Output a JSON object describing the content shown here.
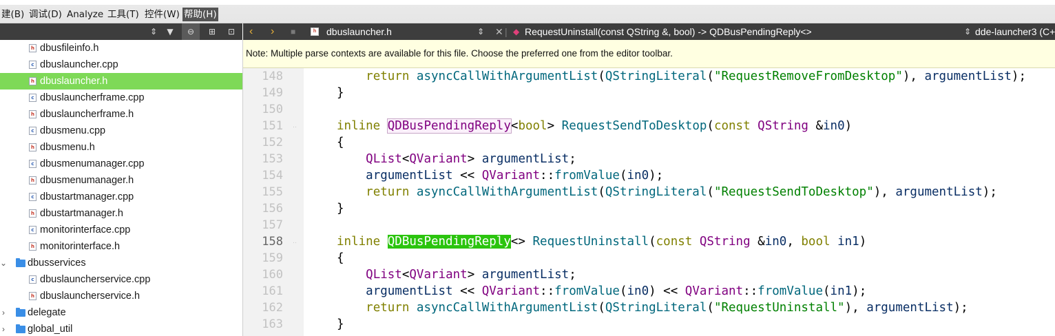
{
  "menubar": {
    "items": [
      {
        "label": "建(B)"
      },
      {
        "label": "调试(D)"
      },
      {
        "label": "Analyze"
      },
      {
        "label": "工具(T)"
      },
      {
        "label": "控件(W)"
      },
      {
        "label": "帮助(H)"
      }
    ]
  },
  "sidebar": {
    "toolbar_icons": [
      "updown-arrows-icon",
      "filter-icon",
      "link-icon",
      "split-add-icon",
      "close-panel-icon"
    ],
    "items": [
      {
        "label": "dbusfileinfo.h",
        "type": "h"
      },
      {
        "label": "dbuslauncher.cpp",
        "type": "cpp"
      },
      {
        "label": "dbuslauncher.h",
        "type": "h",
        "selected": true
      },
      {
        "label": "dbuslauncherframe.cpp",
        "type": "cpp"
      },
      {
        "label": "dbuslauncherframe.h",
        "type": "h"
      },
      {
        "label": "dbusmenu.cpp",
        "type": "cpp"
      },
      {
        "label": "dbusmenu.h",
        "type": "h"
      },
      {
        "label": "dbusmenumanager.cpp",
        "type": "cpp"
      },
      {
        "label": "dbusmenumanager.h",
        "type": "h"
      },
      {
        "label": "dbustartmanager.cpp",
        "type": "cpp"
      },
      {
        "label": "dbustartmanager.h",
        "type": "h"
      },
      {
        "label": "monitorinterface.cpp",
        "type": "cpp"
      },
      {
        "label": "monitorinterface.h",
        "type": "h"
      },
      {
        "label": "dbusservices",
        "type": "folder",
        "expanded": true
      },
      {
        "label": "dbuslauncherservice.cpp",
        "type": "cpp"
      },
      {
        "label": "dbuslauncherservice.h",
        "type": "h"
      },
      {
        "label": "delegate",
        "type": "folder",
        "expanded": false
      },
      {
        "label": "global_util",
        "type": "folder",
        "expanded": false
      }
    ]
  },
  "editor_toolbar": {
    "file_name": "dbuslauncher.h",
    "symbol": "RequestUninstall(const QString &, bool) -> QDBusPendingReply<>",
    "context": "dde-launcher3 (C+"
  },
  "notification": {
    "text": "Note: Multiple parse contexts are available for this file. Choose the preferred one from the editor toolbar."
  },
  "editor": {
    "current_line": 158,
    "line_numbers": [
      "148",
      "149",
      "150",
      "151",
      "152",
      "153",
      "154",
      "155",
      "156",
      "157",
      "158",
      "159",
      "160",
      "161",
      "162",
      "163"
    ],
    "folded_lines": [
      151,
      158
    ],
    "colors": {
      "keyword": "#808000",
      "type": "#800080",
      "function": "#00677c",
      "variable": "#092e64",
      "string": "#008000",
      "selection": "#2bc40e"
    }
  }
}
